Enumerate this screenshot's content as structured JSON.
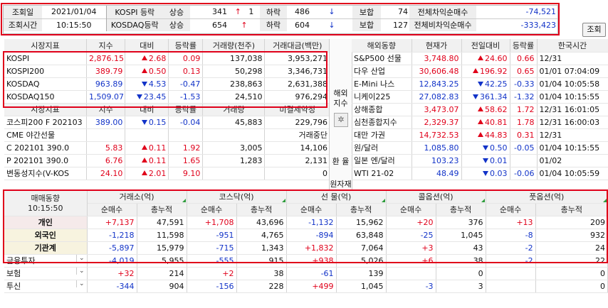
{
  "top": {
    "date_label": "조회일",
    "date_value": "2021/01/04",
    "time_label": "조회시간",
    "time_value": "10:15:50",
    "rows": [
      {
        "name": "KOSPI 등락",
        "up_label": "상승",
        "up": "341",
        "up_arrow": "↑",
        "up_limit": "1",
        "down_label": "하락",
        "down": "486",
        "down_arrow": "↓",
        "flat_label": "보합",
        "flat": "74",
        "prog_label": "전체차익순매수",
        "prog": "-74,521"
      },
      {
        "name": "KOSDAQ등락",
        "up_label": "상승",
        "up": "654",
        "up_arrow": "↑",
        "up_limit": "",
        "down_label": "하락",
        "down": "604",
        "down_arrow": "↓",
        "flat_label": "보합",
        "flat": "127",
        "prog_label": "전체비차익순매수",
        "prog": "-333,423"
      }
    ],
    "query_button": "조회"
  },
  "market": {
    "headers": [
      "시장지표",
      "지수",
      "대비",
      "등락률",
      "거래량(천주)",
      "거래대금(백만)"
    ],
    "rows": [
      {
        "name": "KOSPI",
        "index": "2,876.15",
        "dir": "up",
        "chg": "2.68",
        "rate": "0.09",
        "vol": "137,038",
        "amt": "3,953,271"
      },
      {
        "name": "KOSPI200",
        "index": "389.79",
        "dir": "up",
        "chg": "0.50",
        "rate": "0.13",
        "vol": "50,298",
        "amt": "3,346,731"
      },
      {
        "name": "KOSDAQ",
        "index": "963.89",
        "dir": "dn",
        "chg": "4.53",
        "rate": "-0.47",
        "vol": "238,863",
        "amt": "2,631,388"
      },
      {
        "name": "KOSDAQ150",
        "index": "1,509.07",
        "dir": "dn",
        "chg": "23.45",
        "rate": "-1.53",
        "vol": "24,510",
        "amt": "976,294"
      }
    ],
    "headers2": [
      "시장지표",
      "지수",
      "대비",
      "등락률",
      "거래량",
      "미결제약정"
    ],
    "rows2": [
      {
        "name": "코스피200 F 202103",
        "index": "389.00",
        "dir": "dn",
        "chg": "0.15",
        "rate": "-0.04",
        "vol": "45,883",
        "amt": "229,796"
      },
      {
        "name": "CME 야간선물",
        "index": "",
        "dir": "",
        "chg": "",
        "rate": "",
        "vol": "",
        "amt": "거래중단"
      },
      {
        "name": "C 202101 390.0",
        "index": "5.83",
        "dir": "up",
        "chg": "0.11",
        "rate": "1.92",
        "vol": "3,005",
        "amt": "14,106"
      },
      {
        "name": "P 202101 390.0",
        "index": "6.76",
        "dir": "up",
        "chg": "0.11",
        "rate": "1.65",
        "vol": "1,283",
        "amt": "2,131"
      },
      {
        "name": "변동성지수(V-KOS",
        "index": "24.10",
        "dir": "up",
        "chg": "2.01",
        "rate": "9.10",
        "vol": "",
        "amt": "0"
      }
    ]
  },
  "mid": {
    "overseas_label": "해외\n지수",
    "gear_icon": "gear",
    "exchange_label": "환 율",
    "raw_label": "원자재"
  },
  "world": {
    "headers": [
      "해외동향",
      "현재가",
      "전일대비",
      "등락률",
      "한국시간"
    ],
    "rows": [
      {
        "name": "S&P500 선물",
        "price": "3,748.80",
        "dir": "up",
        "chg": "24.60",
        "rate": "0.66",
        "time": "12/31"
      },
      {
        "name": "다우 산업",
        "price": "30,606.48",
        "dir": "up",
        "chg": "196.92",
        "rate": "0.65",
        "time": "01/01  07:04:09"
      },
      {
        "name": "E-Mini 나스",
        "price": "12,843.25",
        "dir": "dn",
        "chg": "42.25",
        "rate": "-0.33",
        "time": "01/04  10:05:58"
      },
      {
        "name": "니케이225",
        "price": "27,082.83",
        "dir": "dn",
        "chg": "361.34",
        "rate": "-1.32",
        "time": "01/04  10:15:55"
      },
      {
        "name": "상해종합",
        "price": "3,473.07",
        "dir": "up",
        "chg": "58.62",
        "rate": "1.72",
        "time": "12/31  16:01:05"
      },
      {
        "name": "심천종합지수",
        "price": "2,329.37",
        "dir": "up",
        "chg": "40.81",
        "rate": "1.78",
        "time": "12/31  16:00:03"
      },
      {
        "name": "대만 가권",
        "price": "14,732.53",
        "dir": "up",
        "chg": "44.83",
        "rate": "0.31",
        "time": "12/31"
      },
      {
        "name": "원/달러",
        "price": "1,085.80",
        "dir": "dn",
        "chg": "0.50",
        "rate": "-0.05",
        "time": "01/04  10:15:55"
      },
      {
        "name": "일본 엔/달러",
        "price": "103.23",
        "dir": "dn",
        "chg": "0.01",
        "rate": "",
        "time": "01/02"
      },
      {
        "name": "WTI 21-02",
        "price": "48.49",
        "dir": "dn",
        "chg": "0.03",
        "rate": "-0.06",
        "time": "01/04  10:05:59"
      }
    ]
  },
  "flow": {
    "title": "매매동향",
    "time": "10:15:50",
    "groups": [
      "거래소(억)",
      "코스닥(억)",
      "선  물(억)",
      "콜옵션(억)",
      "풋옵션(억)"
    ],
    "sub": [
      "순매수",
      "총누적"
    ],
    "rows": [
      {
        "name": "개인",
        "cls": "cat",
        "vals": [
          "+7,137",
          "47,591",
          "+1,708",
          "43,696",
          "-1,132",
          "15,962",
          "+20",
          "376",
          "+13",
          "209"
        ]
      },
      {
        "name": "외국인",
        "cls": "cat2",
        "vals": [
          "-1,218",
          "11,598",
          "-951",
          "4,765",
          "-894",
          "63,848",
          "-25",
          "1,045",
          "-8",
          "932"
        ]
      },
      {
        "name": "기관계",
        "cls": "cat2",
        "vals": [
          "-5,897",
          "15,979",
          "-715",
          "1,343",
          "+1,832",
          "7,064",
          "+3",
          "43",
          "-2",
          "24"
        ]
      },
      {
        "name": "금융투자",
        "cls": "dd",
        "vals": [
          "-4,019",
          "5,955",
          "-555",
          "915",
          "+938",
          "5,026",
          "+6",
          "38",
          "-2",
          "22"
        ]
      },
      {
        "name": "보험",
        "cls": "dd",
        "vals": [
          "+32",
          "214",
          "+2",
          "38",
          "-61",
          "139",
          "",
          "0",
          "",
          "0"
        ]
      },
      {
        "name": "투신",
        "cls": "dd",
        "vals": [
          "-344",
          "904",
          "-156",
          "228",
          "+499",
          "1,045",
          "-3",
          "3",
          "",
          "0"
        ]
      }
    ]
  },
  "colors": {
    "accent": "#e0001a",
    "up": "#e0001a",
    "down": "#1233c8",
    "header_bg": "#f1f1f1"
  }
}
